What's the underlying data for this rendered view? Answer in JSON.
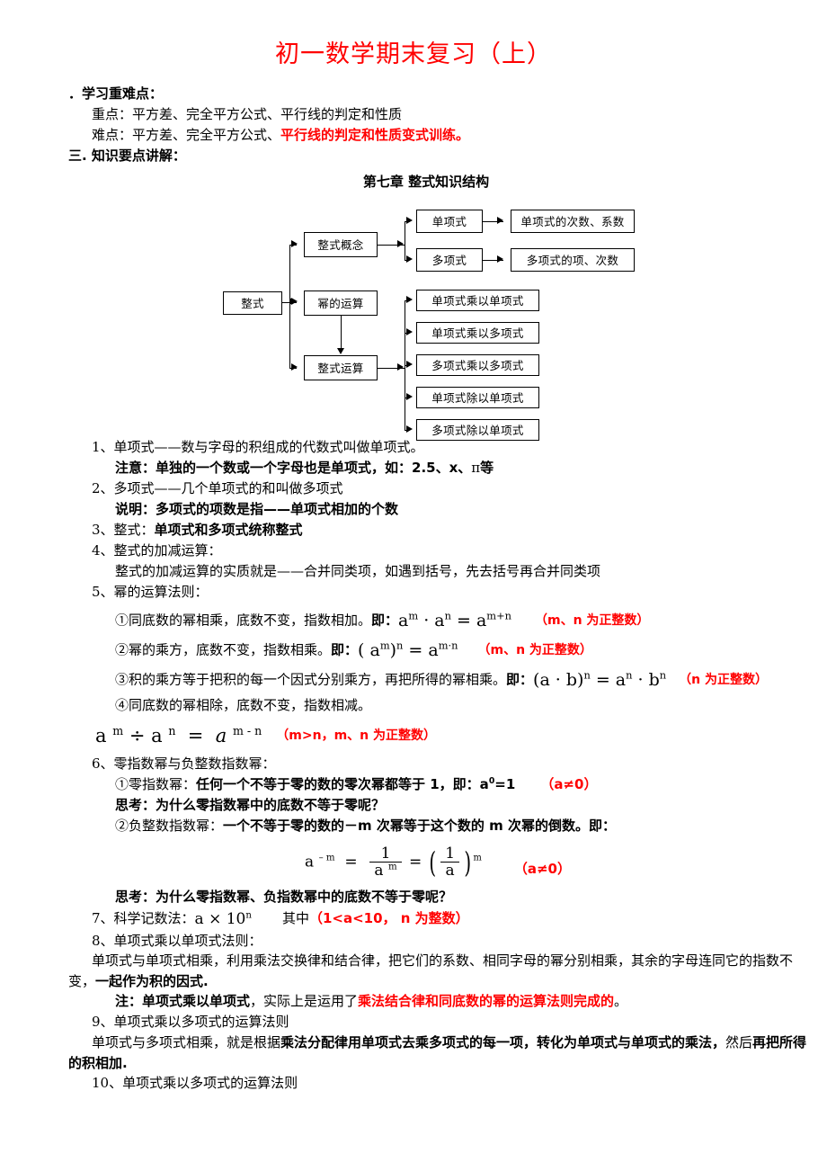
{
  "document": {
    "title": "初一数学期末复习（上）"
  },
  "sections": {
    "focus_heading": "．学习重难点：",
    "key_point_label": "重点：",
    "key_point_text": "平方差、完全平方公式、平行线的判定和性质",
    "difficulty_label": "难点：",
    "difficulty_text_plain": "平方差、完全平方公式、",
    "difficulty_text_red": "平行线的判定和性质变式训练。",
    "knowledge_heading": "三. 知识要点讲解："
  },
  "diagram": {
    "title": "第七章  整式知识结构",
    "root": "整式",
    "level1": [
      "整式概念",
      "幂的运算",
      "整式运算"
    ],
    "concept_children": [
      "单项式",
      "多项式"
    ],
    "concept_grandchildren": [
      "单项式的次数、系数",
      "多项式的项、次数"
    ],
    "operation_children": [
      "单项式乘以单项式",
      "单项式乘以多项式",
      "多项式乘以多项式",
      "单项式除以单项式",
      "多项式除以单项式"
    ]
  },
  "items": {
    "i1": "1、单项式——数与字母的积组成的代数式叫做单项式。",
    "i1_note_label": "注意：",
    "i1_note_text": "单独的一个数或一个字母也是单项式，如：2.5、x、",
    "i1_note_pi": "π",
    "i1_note_tail": "等",
    "i2": "2、多项式——几个单项式的和叫做多项式",
    "i2_note_label": "说明：",
    "i2_note_text": "多项式的项数是指——单项式相加的个数",
    "i3_num": "3、整式：",
    "i3_text": "单项式和多项式统称整式",
    "i4": "4、整式的加减运算：",
    "i4_detail": "整式的加减运算的实质就是——合并同类项，如遇到括号，先去括号再合并同类项",
    "i5": "5、幂的运算法则：",
    "i5_a": "①同底数的幂相乘，底数不变，指数相加。",
    "i5_a_ji": "即：",
    "i5_a_note": "（m、n 为正整数）",
    "i5_b": "②幂的乘方，底数不变，指数相乘。",
    "i5_b_ji": "即：",
    "i5_b_note": "（m、n 为正整数）",
    "i5_c": "③积的乘方等于把积的每一个因式分别乘方，再把所得的幂相乘。",
    "i5_c_ji": "即：",
    "i5_c_note": "（n 为正整数）",
    "i5_d": "④同底数的幂相除，底数不变，指数相减。",
    "i5_d_note": "（m>n，m、n 为正整数）",
    "i6": "6、零指数幂与负整数指数幂：",
    "i6_a_label": "①零指数幂：",
    "i6_a_text": "任何一个不等于零的数的零次幂都等于 1，即：a",
    "i6_a_sup": "0",
    "i6_a_tail": "=1",
    "i6_a_note": "（a≠0）",
    "i6_think1": "思考：为什么零指数幂中的底数不等于零呢？",
    "i6_b_label": "②负整数指数幂：",
    "i6_b_text": "一个不等于零的数的－m 次幂等于这个数的 m 次幂的倒数。即：",
    "i6_b_note": "（a≠0）",
    "i6_think2": "思考：为什么零指数幂、负指数幂中的底数不等于零呢？",
    "i7_label": "7、科学记数法：",
    "i7_where": "其中",
    "i7_note": "（1<a<10， n 为整数）",
    "i8": "8、单项式乘以单项式法则：",
    "i8_text_a": "单项式与单项式相乘，利用乘法交换律和结合律，把它们的系数、相同字母的幂分别相乘，其余的字母连同它的指数不变，",
    "i8_text_b": "一起作为积的因式.",
    "i8_note_label": "注：单项式乘以单项式",
    "i8_note_mid": "，实际上是运用了",
    "i8_note_red": "乘法结合律和同底数的幂的运算法则完成的",
    "i8_note_tail": "。",
    "i9": "9、单项式乘以多项式的运算法则",
    "i9_text_a": "单项式与多项式相乘，就是根据",
    "i9_text_b": "乘法分配律用单项式去乘多项式的每一项，转化为单项式与单项式的乘法，",
    "i9_text_c": "然后",
    "i9_text_d": "再把所得的积相加.",
    "i10": "10、单项式乘以多项式的运算法则"
  },
  "formulas": {
    "f_same_base_mult": "a^m · a^n = a^(m+n)",
    "f_power_of_power": "(a^m)^n = a^(m·n)",
    "f_power_of_product": "(a·b)^n = a^n · b^n",
    "f_division": "a^m ÷ a^n = a^(m-n)",
    "f_negative_exp": "a^(-m) = 1/a^m = (1/a)^m",
    "f_scientific": "a × 10^n"
  },
  "colors": {
    "accent_red": "#ff0000",
    "text": "#000000",
    "background": "#ffffff"
  }
}
